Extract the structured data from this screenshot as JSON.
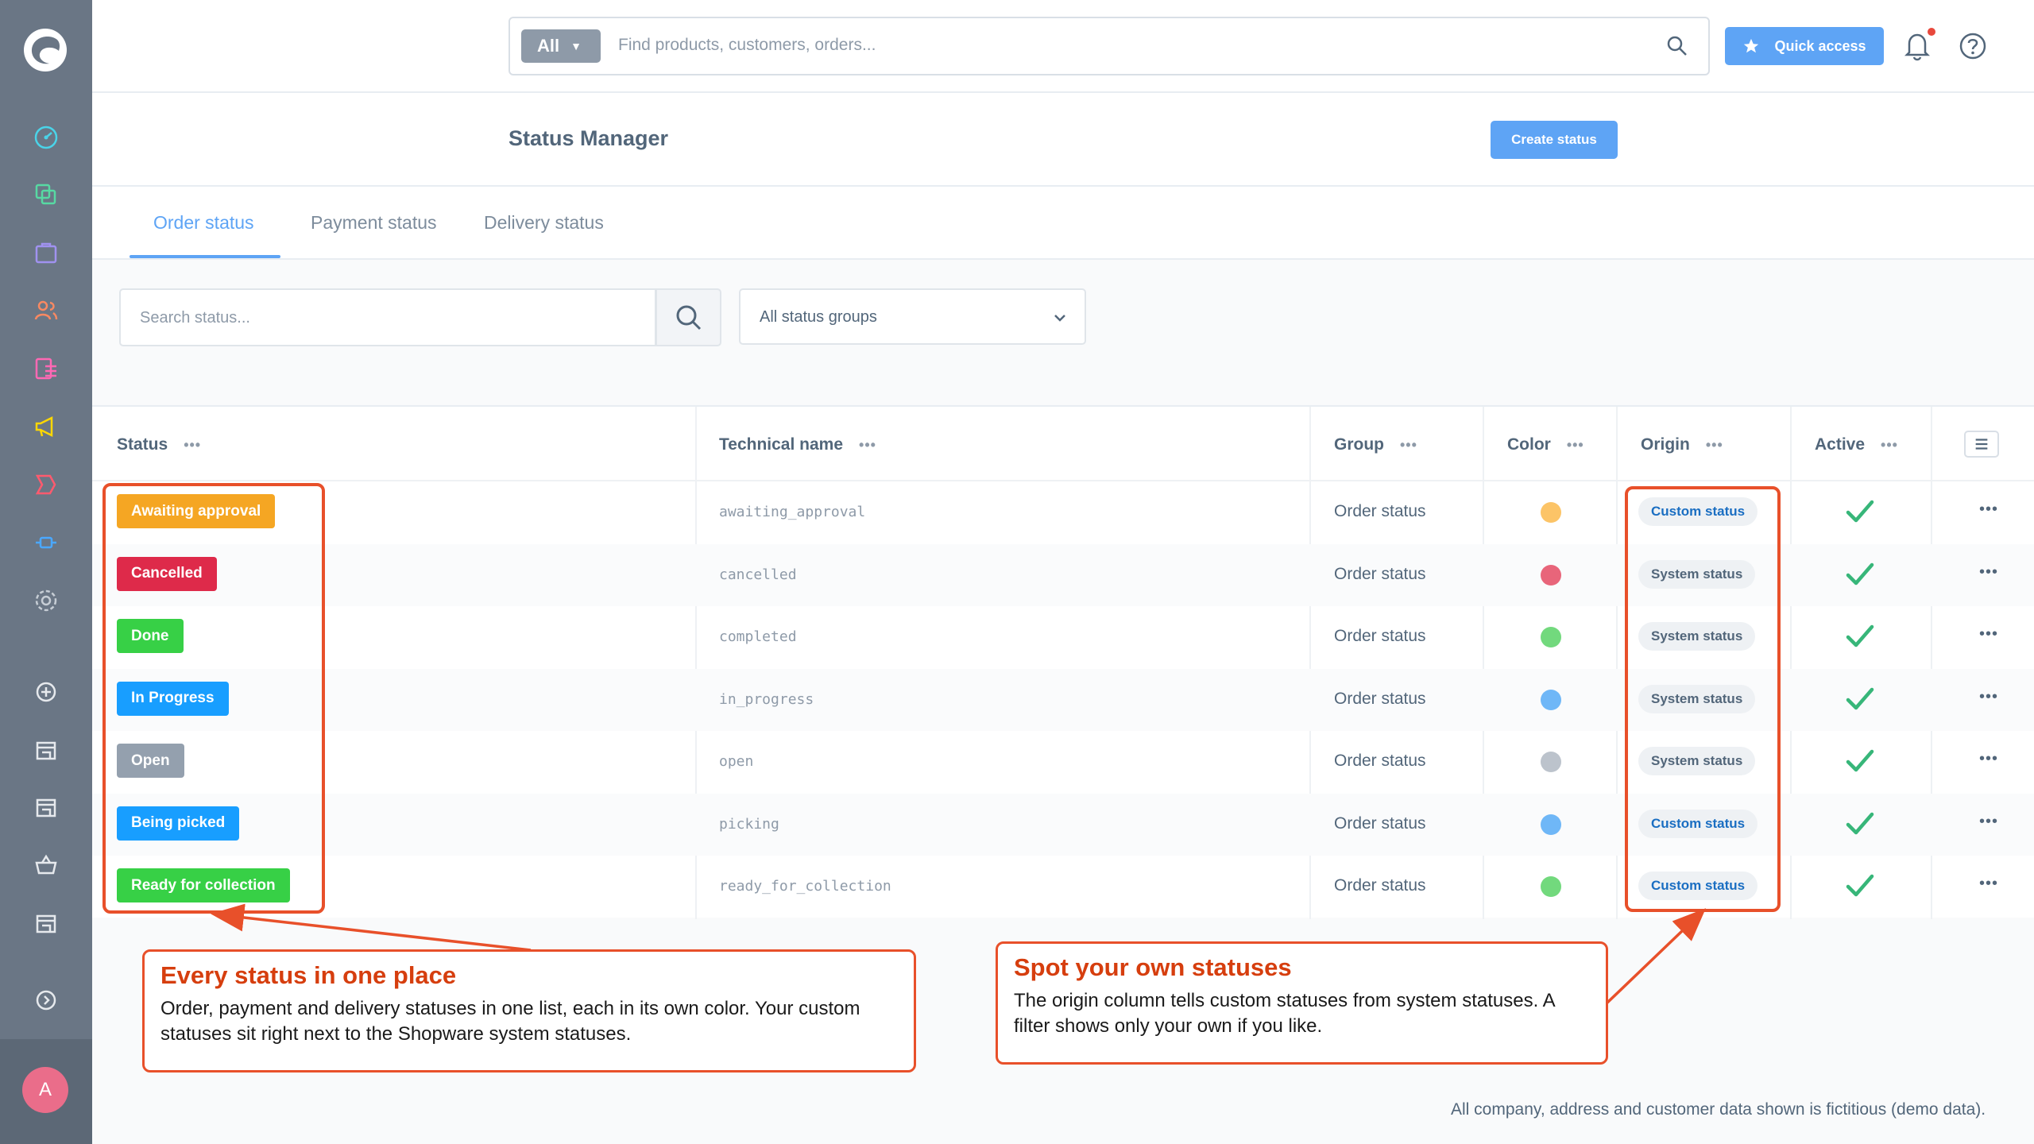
{
  "topbar": {
    "search_type": "All",
    "search_placeholder": "Find products, customers, orders...",
    "quick_access_label": "Quick access"
  },
  "sidebar": {
    "avatar_initial": "A"
  },
  "page": {
    "title": "Status Manager",
    "create_button": "Create status"
  },
  "tabs": [
    "Order status",
    "Payment status",
    "Delivery status"
  ],
  "filters": {
    "search_placeholder": "Search status...",
    "group_select_value": "All status groups"
  },
  "table": {
    "columns": [
      "Status",
      "Technical name",
      "Group",
      "Color",
      "Origin",
      "Active"
    ],
    "rows": [
      {
        "status": "Awaiting approval",
        "status_color": "#f5a623",
        "technical_name": "awaiting_approval",
        "group": "Order status",
        "dot_color": "#fcc467",
        "origin": "Custom status",
        "origin_color": "#1a6ec2",
        "active": true
      },
      {
        "status": "Cancelled",
        "status_color": "#de2a4a",
        "technical_name": "cancelled",
        "group": "Order status",
        "dot_color": "#e8657a",
        "origin": "System status",
        "origin_color": "#52667a",
        "active": true
      },
      {
        "status": "Done",
        "status_color": "#37d046",
        "technical_name": "completed",
        "group": "Order status",
        "dot_color": "#72d97d",
        "origin": "System status",
        "origin_color": "#52667a",
        "active": true
      },
      {
        "status": "In Progress",
        "status_color": "#189eff",
        "technical_name": "in_progress",
        "group": "Order status",
        "dot_color": "#6fb7f7",
        "origin": "System status",
        "origin_color": "#52667a",
        "active": true
      },
      {
        "status": "Open",
        "status_color": "#94a0ae",
        "technical_name": "open",
        "group": "Order status",
        "dot_color": "#bcc3cc",
        "origin": "System status",
        "origin_color": "#52667a",
        "active": true
      },
      {
        "status": "Being picked",
        "status_color": "#189eff",
        "technical_name": "picking",
        "group": "Order status",
        "dot_color": "#6fb7f7",
        "origin": "Custom status",
        "origin_color": "#1a6ec2",
        "active": true
      },
      {
        "status": "Ready for collection",
        "status_color": "#37d046",
        "technical_name": "ready_for_collection",
        "group": "Order status",
        "dot_color": "#72d97d",
        "origin": "Custom status",
        "origin_color": "#1a6ec2",
        "active": true
      }
    ]
  },
  "callouts": {
    "left": {
      "title": "Every status in one place",
      "text": "Order, payment and delivery statuses in one list, each in its own color. Your custom statuses sit right next to the Shopware system statuses."
    },
    "right": {
      "title": "Spot your own statuses",
      "text": "The origin column tells custom statuses from system statuses. A filter shows only your own if you like."
    }
  },
  "footnote": "All company, address and customer data shown is fictitious (demo data).",
  "colors": {
    "accent": "#5ea4f5",
    "callout": "#e8502a",
    "check": "#37b679"
  },
  "icons": [
    "shopware-logo",
    "dashboard-icon",
    "catalogue-icon",
    "orders-icon",
    "customers-icon",
    "content-icon",
    "marketing-icon",
    "extensions-icon",
    "settings-icon",
    "add-channel-icon",
    "storefront-icon",
    "headless-icon",
    "basket-icon",
    "chevron-circle-icon",
    "search-icon",
    "star-icon",
    "bell-icon",
    "help-icon",
    "check-icon",
    "menu-icon"
  ]
}
